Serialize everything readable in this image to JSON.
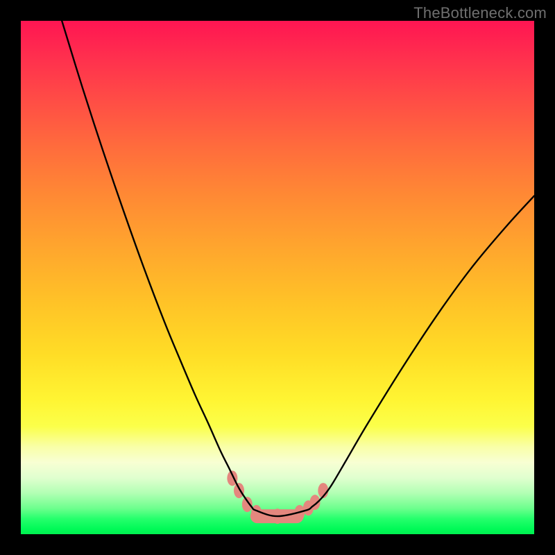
{
  "attribution": "TheBottleneck.com",
  "chart_data": {
    "type": "line",
    "title": "",
    "xlabel": "",
    "ylabel": "",
    "xlim": [
      0,
      1
    ],
    "ylim": [
      0,
      1
    ],
    "curve": {
      "name": "bottleneck-curve",
      "x": [
        0.08,
        0.12,
        0.16,
        0.2,
        0.24,
        0.28,
        0.311,
        0.34,
        0.365,
        0.389,
        0.405,
        0.422,
        0.432,
        0.449,
        0.459,
        0.5,
        0.554,
        0.568,
        0.581,
        0.595,
        0.608,
        0.635,
        0.676,
        0.743,
        0.811,
        0.878,
        0.946,
        1.0
      ],
      "y": [
        1.0,
        0.87,
        0.747,
        0.63,
        0.518,
        0.413,
        0.338,
        0.27,
        0.216,
        0.162,
        0.13,
        0.095,
        0.078,
        0.054,
        0.046,
        0.035,
        0.046,
        0.054,
        0.065,
        0.081,
        0.1,
        0.146,
        0.216,
        0.324,
        0.427,
        0.519,
        0.6,
        0.659
      ]
    },
    "salmon_markers": {
      "name": "highlight-nodes",
      "color": "#e4877e",
      "x": [
        0.412,
        0.425,
        0.441,
        0.459,
        0.5,
        0.543,
        0.56,
        0.573,
        0.589
      ],
      "y": [
        0.109,
        0.085,
        0.058,
        0.042,
        0.035,
        0.042,
        0.051,
        0.062,
        0.085
      ]
    },
    "salmon_bar": {
      "color": "#e4877e",
      "x0": 0.447,
      "x1": 0.551,
      "y": 0.035,
      "height": 0.027
    }
  }
}
